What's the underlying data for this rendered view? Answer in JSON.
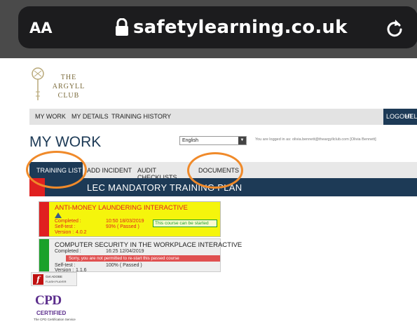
{
  "browser": {
    "text_size_label": "AA",
    "url": "safetylearning.co.uk"
  },
  "site": {
    "logo_line1": "THE",
    "logo_line2": "ARGYLL",
    "logo_line3": "CLUB"
  },
  "nav": {
    "items": [
      {
        "label": "MY WORK"
      },
      {
        "label": "MY DETAILS"
      },
      {
        "label": "TRAINING HISTORY"
      }
    ],
    "logout": "LOGOUT",
    "help": "HELP"
  },
  "page": {
    "title": "MY WORK",
    "language": "English",
    "logged_in_text": "You are logged in as: olivia.bennett@theargyllclub.com [Olivia Bennett]"
  },
  "tabs": [
    {
      "label": "TRAINING LIST"
    },
    {
      "label": "ADD INCIDENT"
    },
    {
      "label": "AUDIT CHECKLISTS"
    },
    {
      "label": "DOCUMENTS"
    }
  ],
  "plan": {
    "title": "LEC MANDATORY TRAINING PLAN"
  },
  "courses": [
    {
      "title": "ANTI-MONEY LAUNDERING INTERACTIVE",
      "completed_label": "Completed :",
      "completed_value": "10:50 18/03/2019",
      "selftest_label": "Self-test :",
      "selftest_value": "93% ( Passed )",
      "version_label": "Version :",
      "version_value": "4.0.2",
      "notice": "This course can be started"
    },
    {
      "title": "COMPUTER SECURITY IN THE WORKPLACE INTERACTIVE",
      "completed_label": "Completed :",
      "completed_value": "16:25 12/04/2019",
      "selftest_label": "Self-test :",
      "selftest_value": "100% ( Passed )",
      "version_label": "Version :",
      "version_value": "1.1.6",
      "notice": "Sorry, you are not permitted to re-start this passed course"
    }
  ],
  "flash": {
    "line1": "Get ADOBE",
    "line2": "FLASH PLAYER"
  },
  "cpd": {
    "big": "CPD",
    "certified": "CERTIFIED",
    "sub": "The CPD Certification Service"
  },
  "colors": {
    "navy": "#1d3a56",
    "highlight_ring": "#f08a2a",
    "status_red": "#e02020",
    "status_green": "#1aa12a",
    "course_yellow": "#f5f50c"
  }
}
